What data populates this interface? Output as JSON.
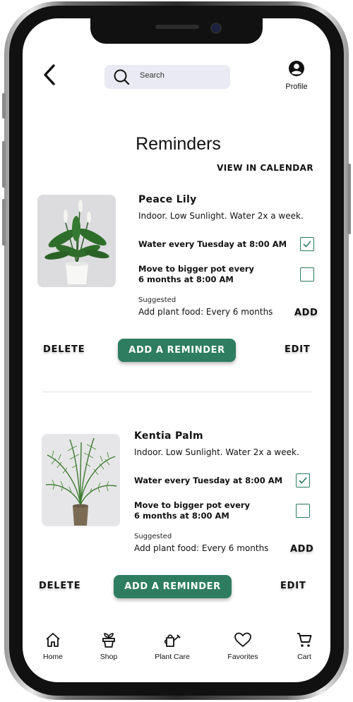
{
  "header": {
    "search_placeholder": "Search",
    "profile_label": "Profile"
  },
  "page": {
    "title": "Reminders",
    "view_calendar": "VIEW IN CALENDAR"
  },
  "plants": [
    {
      "name": "Peace Lily",
      "description": "Indoor. Low Sunlight. Water 2x a week.",
      "reminders": [
        {
          "text": "Water every Tuesday at 8:00 AM",
          "checked": true
        },
        {
          "text_line1": "Move to bigger pot every",
          "text_line2": "6 months at 8:00 AM",
          "checked": false
        }
      ],
      "suggested_label": "Suggested",
      "suggested_text": "Add plant food: Every 6 months",
      "add_label": "ADD",
      "delete_label": "DELETE",
      "add_reminder_label": "ADD A REMINDER",
      "edit_label": "EDIT"
    },
    {
      "name": "Kentia Palm",
      "description": "Indoor. Low Sunlight. Water 2x a week.",
      "reminders": [
        {
          "text": "Water every Tuesday at 8:00 AM",
          "checked": true
        },
        {
          "text_line1": "Move to bigger pot every",
          "text_line2": "6 months at 8:00 AM",
          "checked": false
        }
      ],
      "suggested_label": "Suggested",
      "suggested_text": "Add plant food: Every 6 months",
      "add_label": "ADD",
      "delete_label": "DELETE",
      "add_reminder_label": "ADD A REMINDER",
      "edit_label": "EDIT"
    }
  ],
  "tabbar": [
    {
      "label": "Home",
      "icon": "home-icon"
    },
    {
      "label": "Shop",
      "icon": "plant-pot-icon"
    },
    {
      "label": "Plant Care",
      "icon": "watering-can-icon"
    },
    {
      "label": "Favorites",
      "icon": "heart-icon"
    },
    {
      "label": "Cart",
      "icon": "cart-icon"
    }
  ],
  "colors": {
    "accent": "#2e7d60",
    "search_bg": "#e9eaf3"
  }
}
